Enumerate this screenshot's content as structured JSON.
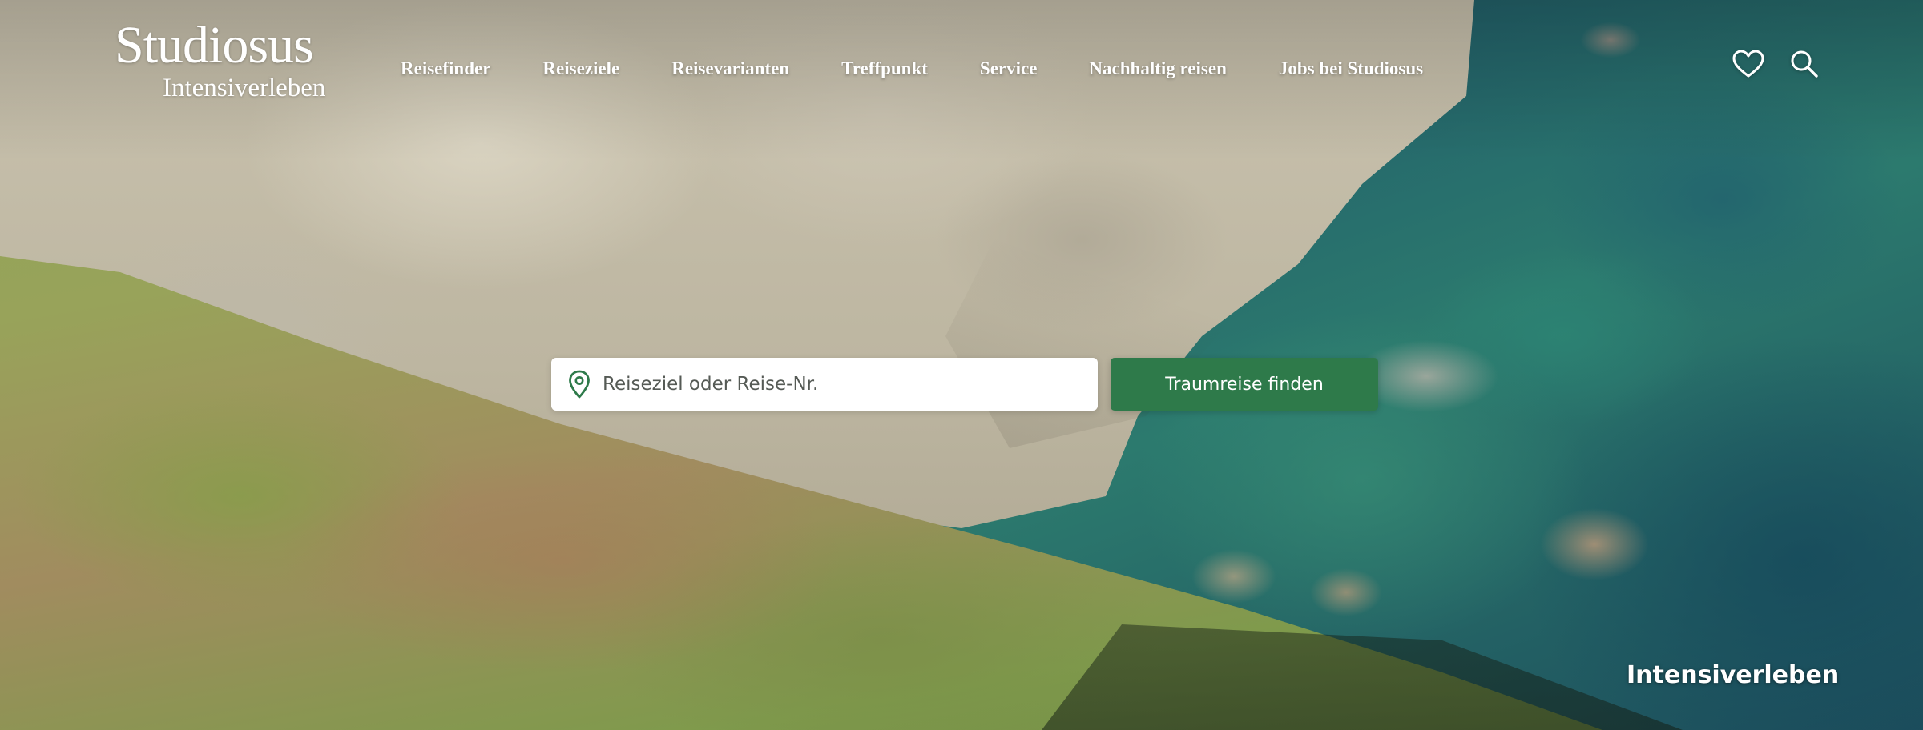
{
  "brand": {
    "name": "Studiosus",
    "tagline": "Intensiverleben"
  },
  "nav": {
    "items": [
      {
        "label": "Reisefinder"
      },
      {
        "label": "Reiseziele"
      },
      {
        "label": "Reisevarianten"
      },
      {
        "label": "Treffpunkt"
      },
      {
        "label": "Service"
      },
      {
        "label": "Nachhaltig reisen"
      },
      {
        "label": "Jobs bei Studiosus"
      }
    ]
  },
  "header_icons": {
    "favorites": "heart-icon",
    "search": "search-icon"
  },
  "search": {
    "icon": "location-pin-icon",
    "placeholder": "Reiseziel oder Reise-Nr.",
    "value": "",
    "button_label": "Traumreise finden"
  },
  "hero": {
    "caption": "Intensiverleben"
  },
  "colors": {
    "accent_green": "#2e7a4a",
    "text_on_image": "#ffffff",
    "pin_green": "#2e7a4a"
  }
}
